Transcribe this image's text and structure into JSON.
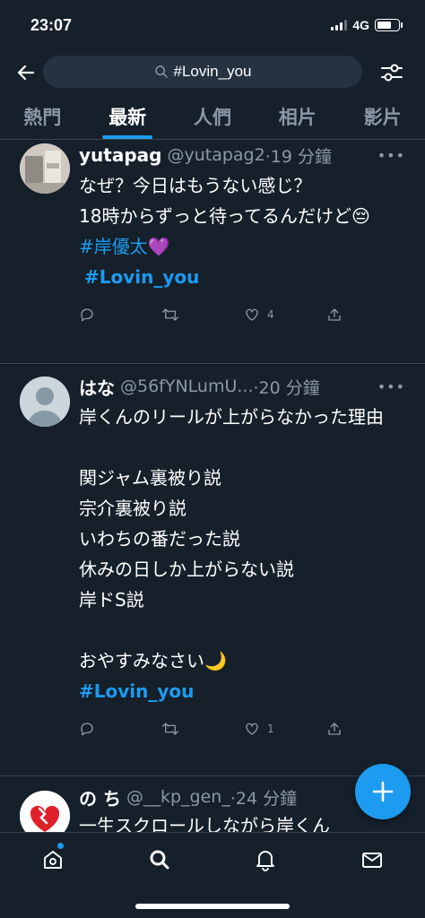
{
  "status_bar": {
    "time": "23:07",
    "network": "4G"
  },
  "search": {
    "query": "#Lovin_you"
  },
  "tabs": [
    {
      "label": "熱門"
    },
    {
      "label": "最新"
    },
    {
      "label": "人們"
    },
    {
      "label": "相片"
    },
    {
      "label": "影片"
    }
  ],
  "tweets": [
    {
      "name": "yutapag",
      "handle": "@yutapag2",
      "time": "·19 分鐘",
      "text": "なぜ？今日はもうない感じ？\n18時からずっと待ってるんだけど😔",
      "hashtag1": "#岸優太💜",
      "hashtag2": "#Lovin_you",
      "likes": "4"
    },
    {
      "name": "はな",
      "handle": "@56fYNLumU...",
      "time": "·20 分鐘",
      "text": "岸くんのリールが上がらなかった理由\n\n関ジャム裏被り説\n宗介裏被り説\nいわちの番だった説\n休みの日しか上がらない説\n岸ドS説\n\nおやすみなさい🌙",
      "hashtag1": "#Lovin_you",
      "likes": "1"
    },
    {
      "name": "の ち",
      "handle": "@__kp_gen_",
      "time": "·24 分鐘",
      "text": "一生スクロールしながら岸くん"
    }
  ],
  "colors": {
    "background": "#15202b",
    "accent": "#1d9bf0",
    "muted": "#8b98a5",
    "divider": "#38444d"
  },
  "icons": {
    "back": "arrow-left-icon",
    "search": "search-icon",
    "filter": "sliders-icon",
    "reply": "reply-icon",
    "retweet": "retweet-icon",
    "like": "heart-icon",
    "share": "share-icon",
    "compose": "plus-icon",
    "home": "home-icon",
    "explore": "search-icon",
    "notifications": "bell-icon",
    "messages": "mail-icon"
  }
}
